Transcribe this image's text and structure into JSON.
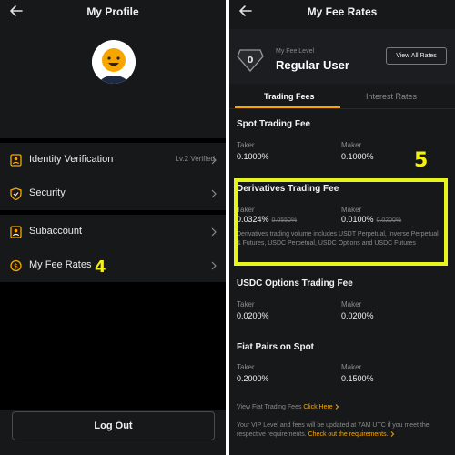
{
  "left": {
    "title": "My Profile",
    "menu": [
      {
        "label": "Identity Verification",
        "right": "Lv.2 Verified",
        "icon": "id-badge-icon"
      },
      {
        "label": "Security",
        "right": "",
        "icon": "shield-icon"
      },
      {
        "label": "Subaccount",
        "right": "",
        "icon": "subaccount-icon"
      },
      {
        "label": "My Fee Rates",
        "right": "",
        "icon": "dollar-coin-icon"
      }
    ],
    "logout_label": "Log Out",
    "step_marker": "4"
  },
  "right": {
    "title": "My Fee Rates",
    "fee_level_label": "My Fee Level",
    "fee_level_value": "Regular User",
    "view_all_label": "View All Rates",
    "tabs": [
      {
        "label": "Trading Fees",
        "active": true
      },
      {
        "label": "Interest Rates",
        "active": false
      }
    ],
    "sections": [
      {
        "title": "Spot Trading Fee",
        "taker_label": "Taker",
        "taker": "0.1000%",
        "maker_label": "Maker",
        "maker": "0.1000%"
      },
      {
        "title": "Derivatives Trading Fee",
        "taker_label": "Taker",
        "taker": "0.0324%",
        "taker_old": "0.0550%",
        "maker_label": "Maker",
        "maker": "0.0100%",
        "maker_old": "0.0200%",
        "note": "Derivatives trading volume includes USDT Perpetual, Inverse Perpetual & Futures, USDC Perpetual, USDC Options and USDC Futures"
      },
      {
        "title": "USDC Options Trading Fee",
        "taker_label": "Taker",
        "taker": "0.0200%",
        "maker_label": "Maker",
        "maker": "0.0200%"
      },
      {
        "title": "Fiat Pairs on Spot",
        "taker_label": "Taker",
        "taker": "0.2000%",
        "maker_label": "Maker",
        "maker": "0.1500%"
      }
    ],
    "fiat_link_prefix": "View Fiat Trading Fees",
    "fiat_link": "Click Here",
    "footer_text": "Your VIP Level and fees will be updated at 7AM UTC if you meet the respective requirements.",
    "footer_link": "Check out the requirements.",
    "step_marker": "5"
  },
  "colors": {
    "accent": "#f7a600",
    "highlight": "#e7f51d",
    "background": "#17181a"
  }
}
